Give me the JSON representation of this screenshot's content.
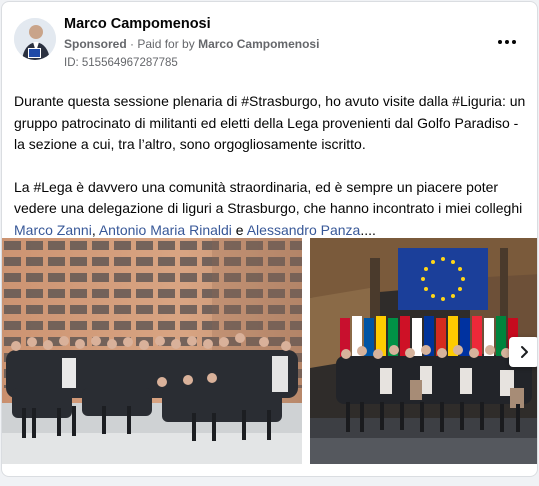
{
  "post": {
    "author": "Marco Campomenosi",
    "sponsored_label": "Sponsored",
    "paid_for_label": "Paid for by",
    "paid_for_name": "Marco Campomenosi",
    "separator": "·",
    "library_id": "ID: 515564967287785",
    "more_icon": "more-horizontal-icon",
    "paragraph1": "Durante questa sessione plenaria di #Strasburgo, ho avuto visite dalla #Liguria: un gruppo patrocinato di militanti ed eletti della Lega provenienti dal Golfo Paradiso - la sezione a cui, tra l’altro, sono orgogliosamente iscritto.",
    "paragraph2_text": "La #Lega è davvero una comunità straordinaria, ed è sempre un piacere poter vedere una delegazione di liguri a Strasburgo, che hanno incontrato i miei colleghi",
    "mention1": "Marco Zanni",
    "comma": ", ",
    "mention2": "Antonio Maria Rinaldi",
    "conjunction": " e ",
    "mention3": "Alessandro Panza",
    "ellipsis": "....",
    "link_color": "#385898"
  },
  "carousel": {
    "next_icon": "chevron-right-icon"
  }
}
